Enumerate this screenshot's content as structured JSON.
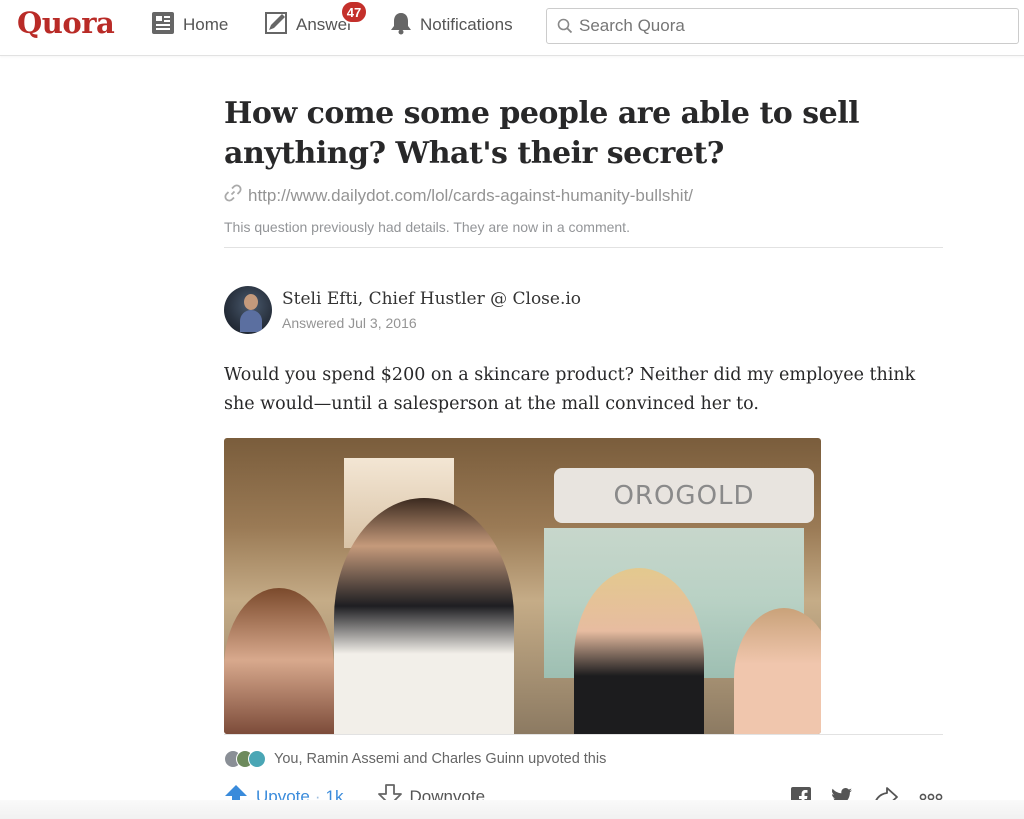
{
  "header": {
    "logo": "Quora",
    "nav": {
      "home": "Home",
      "answer": "Answer",
      "answer_badge": "47",
      "notifications": "Notifications"
    },
    "search_placeholder": "Search Quora"
  },
  "question": {
    "title": "How come some people are able to sell anything? What's their secret?",
    "link": "http://www.dailydot.com/lol/cards-against-humanity-bullshit/",
    "details_note": "This question previously had details. They are now in a comment."
  },
  "answer": {
    "author": "Steli Efti, Chief Hustler @ Close.io",
    "answered": "Answered Jul 3, 2016",
    "text": "Would you spend $200 on a skincare product? Neither did my employee think she would—until a salesperson at the mall convinced her to.",
    "photo_sign": "OROGOLD",
    "upvoters": "You, Ramin Assemi and Charles Guinn upvoted this",
    "upvote_label": "Upvote",
    "upvote_sep": "·",
    "upvote_count": "1k",
    "downvote_label": "Downvote"
  },
  "colors": {
    "brand": "#b92b27",
    "badge": "#c4302b",
    "upvote": "#3a8bdb"
  },
  "icons": [
    "home-icon",
    "answer-pencil-icon",
    "bell-icon",
    "search-icon",
    "link-icon",
    "upvote-arrow-icon",
    "downvote-arrow-icon",
    "facebook-icon",
    "twitter-icon",
    "share-arrow-icon",
    "more-icon"
  ]
}
